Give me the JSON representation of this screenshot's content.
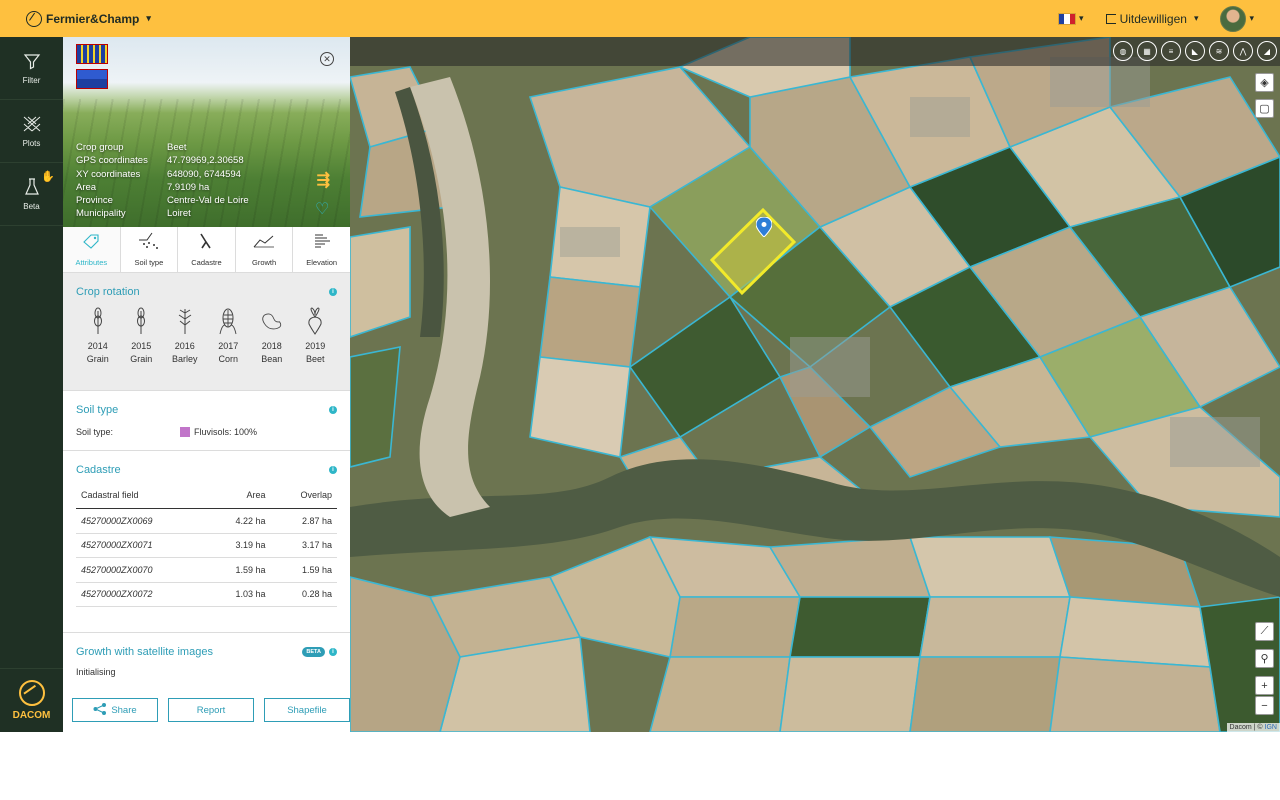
{
  "topbar": {
    "brand": "Fermier&Champ",
    "language": "FR",
    "logout_label": "Uitdewilligen",
    "colors": {
      "bar": "#fec03f"
    }
  },
  "leftnav": {
    "items": [
      {
        "label": "Filter",
        "icon": "filter-icon"
      },
      {
        "label": "Plots",
        "icon": "plots-icon"
      },
      {
        "label": "Beta",
        "icon": "flask-icon"
      }
    ],
    "footer_label": "DACOM"
  },
  "plot": {
    "attributes": [
      {
        "key": "Crop group",
        "value": "Beet"
      },
      {
        "key": "GPS coordinates",
        "value": "47.79969,2.30658"
      },
      {
        "key": "XY coordinates",
        "value": "648090, 6744594"
      },
      {
        "key": "Area",
        "value": "7.9109 ha"
      },
      {
        "key": "Province",
        "value": "Centre-Val de Loire"
      },
      {
        "key": "Municipality",
        "value": "Loiret"
      }
    ]
  },
  "tabs": [
    {
      "label": "Attributes",
      "icon": "tag-icon",
      "active": true
    },
    {
      "label": "Soil type",
      "icon": "soil-icon",
      "active": false
    },
    {
      "label": "Cadastre",
      "icon": "cadastre-icon",
      "active": false
    },
    {
      "label": "Growth",
      "icon": "growth-icon",
      "active": false
    },
    {
      "label": "Elevation",
      "icon": "elevation-icon",
      "active": false
    }
  ],
  "crop_rotation": {
    "title": "Crop rotation",
    "items": [
      {
        "year": "2014",
        "crop": "Grain",
        "icon": "wheat-icon"
      },
      {
        "year": "2015",
        "crop": "Grain",
        "icon": "wheat-icon"
      },
      {
        "year": "2016",
        "crop": "Barley",
        "icon": "barley-icon"
      },
      {
        "year": "2017",
        "crop": "Corn",
        "icon": "corn-icon"
      },
      {
        "year": "2018",
        "crop": "Bean",
        "icon": "bean-icon"
      },
      {
        "year": "2019",
        "crop": "Beet",
        "icon": "beet-icon"
      }
    ]
  },
  "soil": {
    "title": "Soil type",
    "label": "Soil type:",
    "value": "Fluvisols: 100%",
    "color": "#c175c9"
  },
  "cadastre": {
    "title": "Cadastre",
    "columns": [
      "Cadastral field",
      "Area",
      "Overlap"
    ],
    "rows": [
      [
        "45270000ZX0069",
        "4.22 ha",
        "2.87 ha"
      ],
      [
        "45270000ZX0071",
        "3.19 ha",
        "3.17 ha"
      ],
      [
        "45270000ZX0070",
        "1.59 ha",
        "1.59 ha"
      ],
      [
        "45270000ZX0072",
        "1.03 ha",
        "0.28 ha"
      ]
    ]
  },
  "growth": {
    "title": "Growth with satellite images",
    "badge": "BETA",
    "status": "Initialising"
  },
  "actions": {
    "share": "Share",
    "report": "Report",
    "shapefile": "Shapefile"
  },
  "map": {
    "attribution_prefix": "Dacom | ©",
    "attribution_link": "IGN",
    "zoom_in": "+",
    "zoom_out": "−",
    "selected_plot_color": "#f2ea2a",
    "parcel_line_color": "#3ab7d3",
    "tools": [
      "layer-toggle-1-icon",
      "layer-toggle-2-icon",
      "layer-toggle-3-icon",
      "layer-toggle-4-icon",
      "layer-toggle-5-icon",
      "layer-toggle-6-icon",
      "layer-toggle-7-icon"
    ]
  }
}
